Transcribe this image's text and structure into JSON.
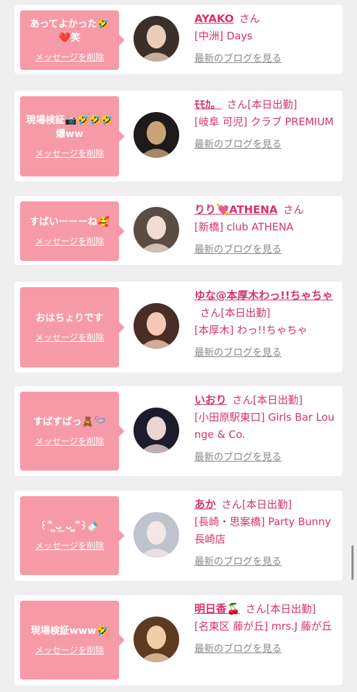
{
  "delete_label": "メッセージを削除",
  "blog_label": "最新のブログを見る",
  "san_label": "さん",
  "accent_color": "#d6336c",
  "bubble_color": "#f79aa7",
  "cards": [
    {
      "message": "あってよかった🤣❤️笑",
      "name": "AYAKO",
      "status": "",
      "shop": "[中洲] Days",
      "avatar": "avatar-photo"
    },
    {
      "message": "現場検証📷🤣🤣🤣爆ww",
      "name": "ﾓﾓｶ。",
      "status": "[本日出勤]",
      "shop": "[岐阜 可児] クラブ PREMIUM",
      "avatar": "avatar-photo"
    },
    {
      "message": "すばいーーーね🥰",
      "name": "りり💘ATHENA",
      "status": "",
      "shop": "[新橋] club ATHENA",
      "avatar": "avatar-photo"
    },
    {
      "message": "おはちょりです",
      "name": "ゆな@本厚木わっ!!ちゃちゃ",
      "status": "[本日出勤]",
      "shop": "[本厚木] わっ!!ちゃちゃ",
      "avatar": "avatar-photo"
    },
    {
      "message": "すばすばっ🧸🪡",
      "name": "いおり",
      "status": "[本日出勤]",
      "shop": "[小田原駅東口] Girls Bar Lounge & Co.",
      "avatar": "avatar-photo"
    },
    {
      "message": "꒰՞ ̳ᴗ̫ ̫ᴗ ̳՞꒱🍼",
      "name": "あか",
      "status": "[本日出勤]",
      "shop": "[長崎・思案橋] Party Bunny 長崎店",
      "avatar": "avatar-photo"
    },
    {
      "message": "現場検証www🤣",
      "name": "明日香🍒",
      "status": "[本日出勤]",
      "shop": "[名東区 藤が丘] mrs.J 藤が丘",
      "avatar": "avatar-photo"
    }
  ]
}
